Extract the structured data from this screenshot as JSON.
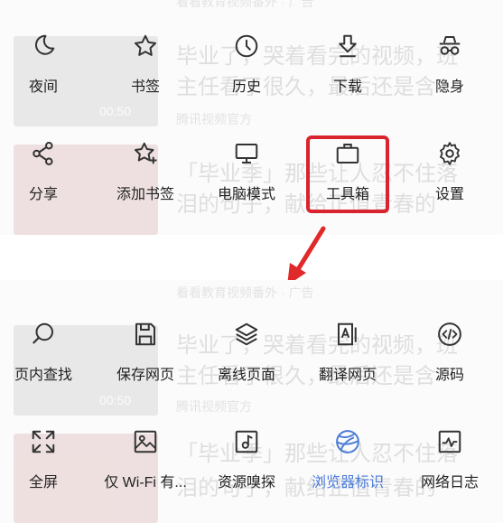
{
  "background": {
    "top_faint": "看看教育视频番外 · 广告",
    "article1_line1": "毕业了，哭着看完的视频，班",
    "article1_line2": "主任看了很久，最后还是含",
    "article1_source": "腾讯视频官方",
    "video_duration": "00:50",
    "article2_line1": "「毕业季」那些让人忍不住落",
    "article2_line2": "泪的句子，献给正值青春的",
    "bottom_faint": "看看教育视频番外 · 广告"
  },
  "menu_top": {
    "row1": [
      {
        "label": "夜间",
        "icon": "moon-icon"
      },
      {
        "label": "书签",
        "icon": "star-icon"
      },
      {
        "label": "历史",
        "icon": "clock-icon"
      },
      {
        "label": "下载",
        "icon": "download-icon"
      },
      {
        "label": "隐身",
        "icon": "incognito-icon"
      }
    ],
    "row2": [
      {
        "label": "分享",
        "icon": "share-icon"
      },
      {
        "label": "添加书签",
        "icon": "star-plus-icon"
      },
      {
        "label": "电脑模式",
        "icon": "monitor-icon"
      },
      {
        "label": "工具箱",
        "icon": "toolbox-icon",
        "highlighted": true
      },
      {
        "label": "设置",
        "icon": "gear-icon"
      }
    ]
  },
  "menu_bottom": {
    "row1": [
      {
        "label": "页内查找",
        "icon": "search-icon"
      },
      {
        "label": "保存网页",
        "icon": "save-icon"
      },
      {
        "label": "离线页面",
        "icon": "layers-icon"
      },
      {
        "label": "翻译网页",
        "icon": "translate-icon"
      },
      {
        "label": "源码",
        "icon": "code-icon"
      }
    ],
    "row2": [
      {
        "label": "全屏",
        "icon": "fullscreen-icon"
      },
      {
        "label": "仅 Wi-Fi 有...",
        "icon": "image-icon"
      },
      {
        "label": "资源嗅探",
        "icon": "music-icon"
      },
      {
        "label": "浏览器标识",
        "icon": "globe-icon",
        "active": true
      },
      {
        "label": "网络日志",
        "icon": "pulse-icon"
      }
    ]
  },
  "colors": {
    "highlight_border": "#d9232e",
    "arrow": "#e02a2a",
    "active_label": "#4a7bd8",
    "icon_stroke": "#333333"
  }
}
